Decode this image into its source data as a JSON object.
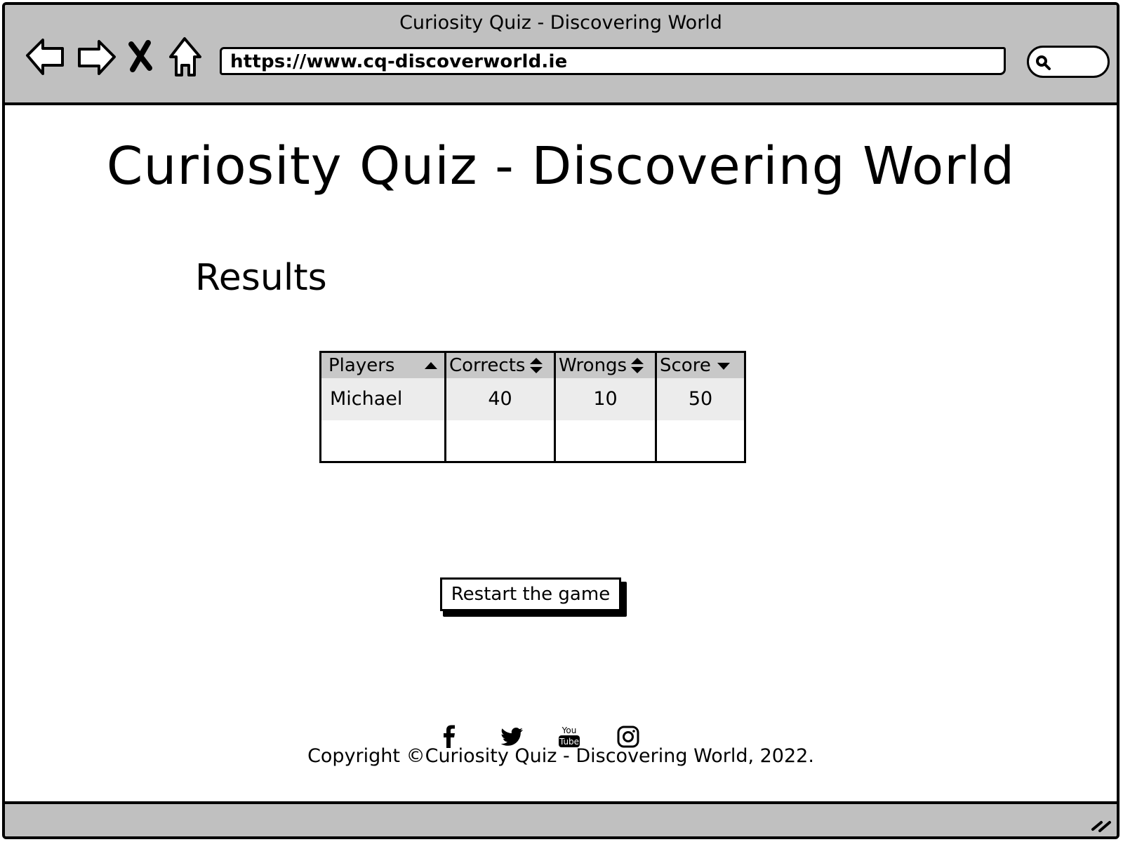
{
  "browser": {
    "title": "Curiosity Quiz - Discovering World",
    "url": "https://www.cq-discoverworld.ie",
    "nav_icons": [
      "back-icon",
      "forward-icon",
      "stop-icon",
      "home-icon"
    ]
  },
  "page": {
    "title": "Curiosity Quiz - Discovering World",
    "results_heading": "Results"
  },
  "table": {
    "columns": [
      {
        "label": "Players",
        "sort": "ascending"
      },
      {
        "label": "Corrects",
        "sort": "both"
      },
      {
        "label": "Wrongs",
        "sort": "both"
      },
      {
        "label": "Score",
        "sort": "descending"
      }
    ],
    "rows": [
      {
        "player": "Michael",
        "corrects": "40",
        "wrongs": "10",
        "score": "50"
      }
    ]
  },
  "actions": {
    "restart_label": "Restart the game"
  },
  "footer": {
    "social_icons": [
      "facebook-icon",
      "twitter-icon",
      "youtube-icon",
      "instagram-icon"
    ],
    "youtube_text": [
      "You",
      "Tube"
    ],
    "copyright_prefix": "Copyright",
    "copyright_symbol": "©",
    "copyright_text": "Curiosity Quiz - Discovering World, 2022."
  }
}
